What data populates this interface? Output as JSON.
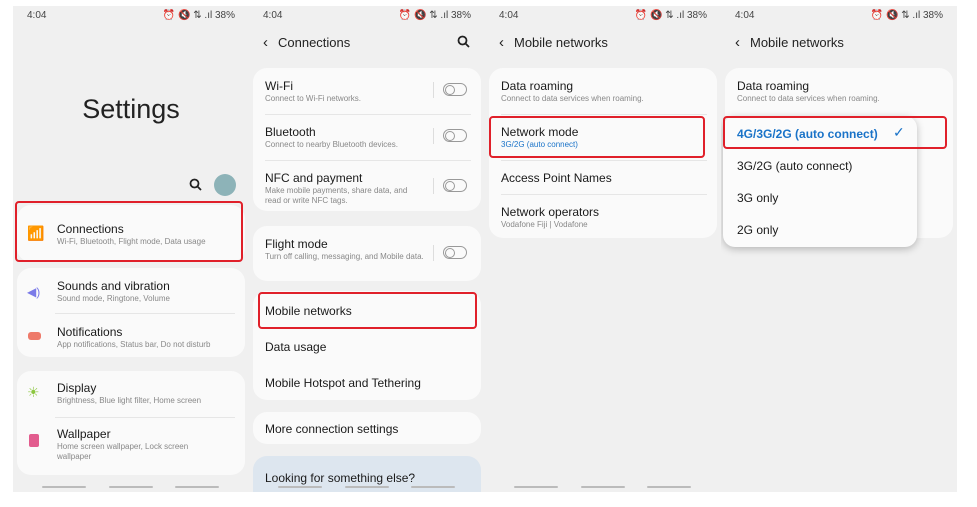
{
  "status": {
    "time": "4:04",
    "battery": "38%"
  },
  "p1": {
    "title": "Settings",
    "items": [
      {
        "label": "Connections",
        "sub": "Wi-Fi, Bluetooth, Flight mode, Data usage"
      },
      {
        "label": "Sounds and vibration",
        "sub": "Sound mode, Ringtone, Volume"
      },
      {
        "label": "Notifications",
        "sub": "App notifications, Status bar, Do not disturb"
      },
      {
        "label": "Display",
        "sub": "Brightness, Blue light filter, Home screen"
      },
      {
        "label": "Wallpaper",
        "sub": "Home screen wallpaper, Lock screen wallpaper"
      }
    ]
  },
  "p2": {
    "title": "Connections",
    "items": [
      {
        "label": "Wi-Fi",
        "sub": "Connect to Wi-Fi networks.",
        "toggle": false
      },
      {
        "label": "Bluetooth",
        "sub": "Connect to nearby Bluetooth devices.",
        "toggle": false
      },
      {
        "label": "NFC and payment",
        "sub": "Make mobile payments, share data, and read or write NFC tags.",
        "toggle": false
      },
      {
        "label": "Flight mode",
        "sub": "Turn off calling, messaging, and Mobile data.",
        "toggle": false
      },
      {
        "label": "Mobile networks"
      },
      {
        "label": "Data usage"
      },
      {
        "label": "Mobile Hotspot and Tethering"
      },
      {
        "label": "More connection settings"
      },
      {
        "label": "Looking for something else?"
      }
    ]
  },
  "p3": {
    "title": "Mobile networks",
    "items": [
      {
        "label": "Data roaming",
        "sub": "Connect to data services when roaming."
      },
      {
        "label": "Network mode",
        "sub": "3G/2G (auto connect)"
      },
      {
        "label": "Access Point Names"
      },
      {
        "label": "Network operators",
        "sub": "Vodafone Fiji | Vodafone"
      }
    ]
  },
  "p4": {
    "title": "Mobile networks",
    "options": [
      "4G/3G/2G (auto connect)",
      "3G/2G (auto connect)",
      "3G only",
      "2G only"
    ],
    "selected": "4G/3G/2G (auto connect)"
  },
  "colors": {
    "accent": "#1a73c8",
    "highlight": "#e0202a"
  }
}
